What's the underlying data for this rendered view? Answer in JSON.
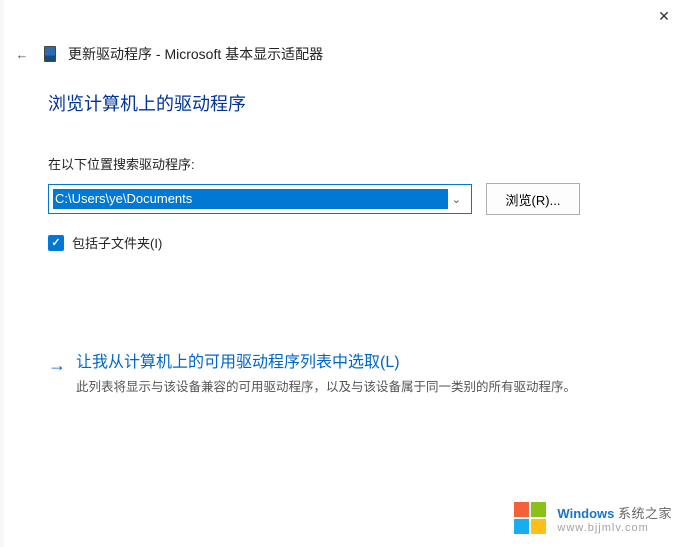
{
  "titlebar": {
    "close_label": "✕"
  },
  "header": {
    "back_label": "←",
    "title": "更新驱动程序 - Microsoft 基本显示适配器"
  },
  "main": {
    "heading": "浏览计算机上的驱动程序",
    "search_label": "在以下位置搜索驱动程序:",
    "path_value": "C:\\Users\\ye\\Documents",
    "browse_button": "浏览(R)...",
    "include_subfolders": "包括子文件夹(I)",
    "include_subfolders_checked": true
  },
  "option": {
    "title": "让我从计算机上的可用驱动程序列表中选取(L)",
    "description": "此列表将显示与该设备兼容的可用驱动程序，以及与该设备属于同一类别的所有驱动程序。"
  },
  "watermark": {
    "brand": "Windows",
    "slogan": "系统之家",
    "url": "www.bjjmlv.com"
  }
}
